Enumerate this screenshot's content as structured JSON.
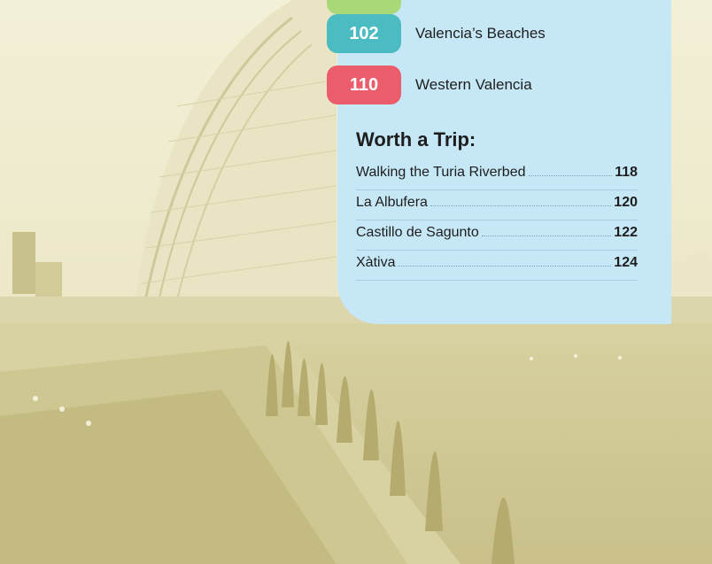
{
  "colors": {
    "panel": "#c6e7f6",
    "badge_green": "#a8d878",
    "badge_teal": "#4bbcc2",
    "badge_red": "#ec5d6c",
    "photo_tint": "#d9d3a6"
  },
  "chapters": [
    {
      "page": "",
      "title": "",
      "color": "#a8d878"
    },
    {
      "page": "102",
      "title": "Valencia’s Beaches",
      "color": "#4bbcc2"
    },
    {
      "page": "110",
      "title": "Western Valencia",
      "color": "#ec5d6c"
    }
  ],
  "worth_a_trip": {
    "heading": "Worth a Trip:",
    "items": [
      {
        "name": "Walking the Turia Riverbed",
        "page": "118"
      },
      {
        "name": "La Albufera",
        "page": "120"
      },
      {
        "name": "Castillo de Sagunto",
        "page": "122"
      },
      {
        "name": "Xàtiva",
        "page": "124"
      }
    ]
  }
}
